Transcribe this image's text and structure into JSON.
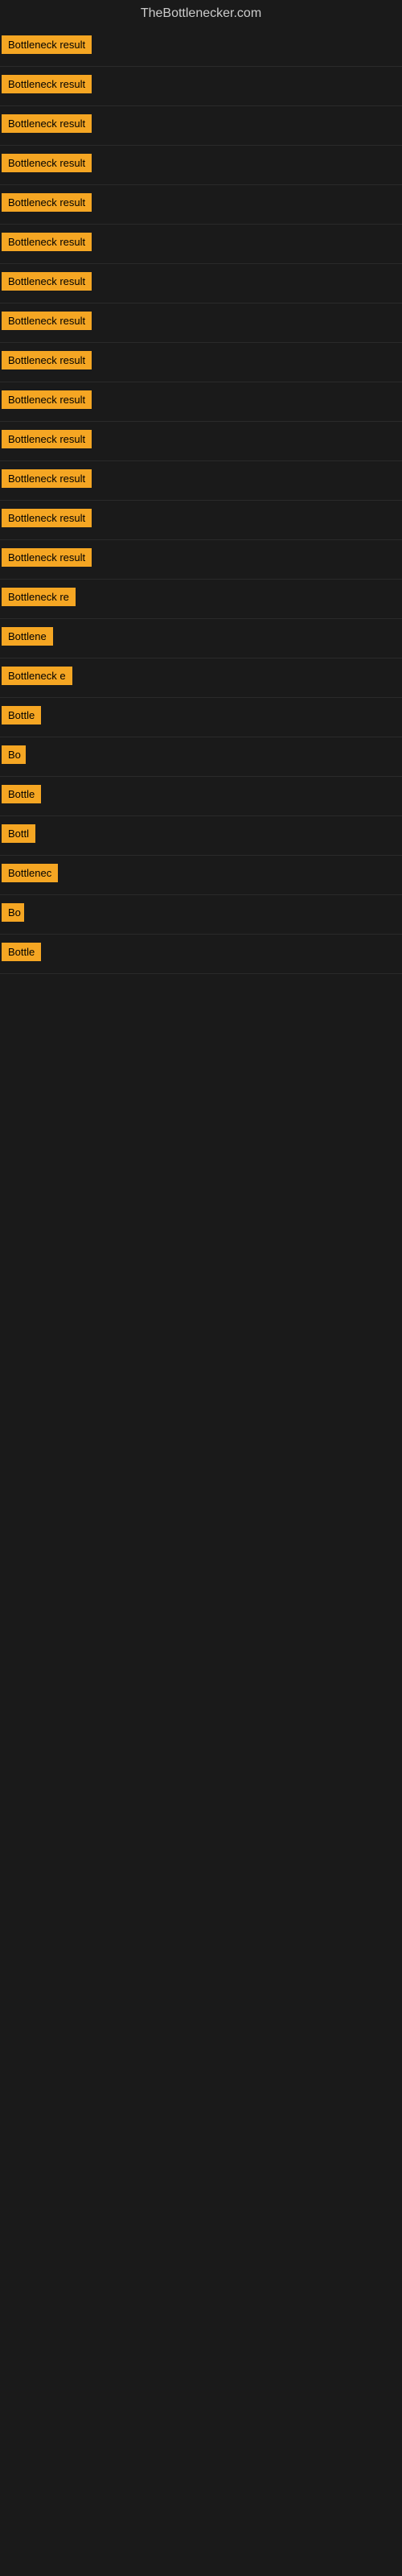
{
  "site": {
    "title": "TheBottlenecker.com"
  },
  "rows": [
    {
      "label": "Bottleneck result",
      "width": 130
    },
    {
      "label": "Bottleneck result",
      "width": 130
    },
    {
      "label": "Bottleneck result",
      "width": 130
    },
    {
      "label": "Bottleneck result",
      "width": 130
    },
    {
      "label": "Bottleneck result",
      "width": 130
    },
    {
      "label": "Bottleneck result",
      "width": 130
    },
    {
      "label": "Bottleneck result",
      "width": 130
    },
    {
      "label": "Bottleneck result",
      "width": 130
    },
    {
      "label": "Bottleneck result",
      "width": 130
    },
    {
      "label": "Bottleneck result",
      "width": 130
    },
    {
      "label": "Bottleneck result",
      "width": 130
    },
    {
      "label": "Bottleneck result",
      "width": 130
    },
    {
      "label": "Bottleneck result",
      "width": 130
    },
    {
      "label": "Bottleneck result",
      "width": 130
    },
    {
      "label": "Bottleneck re",
      "width": 100
    },
    {
      "label": "Bottlene",
      "width": 80
    },
    {
      "label": "Bottleneck e",
      "width": 90
    },
    {
      "label": "Bottle",
      "width": 65
    },
    {
      "label": "Bo",
      "width": 30
    },
    {
      "label": "Bottle",
      "width": 65
    },
    {
      "label": "Bottl",
      "width": 55
    },
    {
      "label": "Bottlenec",
      "width": 85
    },
    {
      "label": "Bo",
      "width": 28
    },
    {
      "label": "Bottle",
      "width": 58
    }
  ]
}
